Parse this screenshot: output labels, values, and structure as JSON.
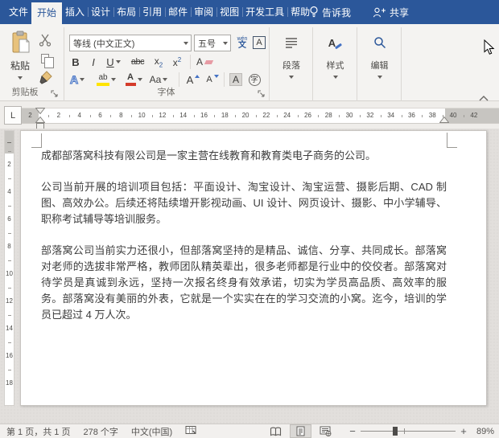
{
  "titlebar": {
    "tabs": [
      {
        "label": "文件",
        "active": false
      },
      {
        "label": "开始",
        "active": true
      },
      {
        "label": "插入",
        "active": false
      },
      {
        "label": "设计",
        "active": false
      },
      {
        "label": "布局",
        "active": false
      },
      {
        "label": "引用",
        "active": false
      },
      {
        "label": "邮件",
        "active": false
      },
      {
        "label": "审阅",
        "active": false
      },
      {
        "label": "视图",
        "active": false
      },
      {
        "label": "开发工具",
        "active": false
      },
      {
        "label": "帮助",
        "active": false
      }
    ],
    "tell_me": "告诉我",
    "share": "共享"
  },
  "ribbon": {
    "clipboard": {
      "group_label": "剪贴板",
      "paste_label": "粘贴"
    },
    "font": {
      "group_label": "字体",
      "font_name": "等线 (中文正文)",
      "font_size": "五号",
      "bold": "B",
      "italic": "I",
      "underline": "U",
      "strikethrough": "abc",
      "subscript_base": "x",
      "subscript_mark": "2",
      "superscript_base": "x",
      "superscript_mark": "2",
      "clear_format": "A",
      "text_effects": "A",
      "highlight": "ab",
      "font_color": "A",
      "change_case": "Aa",
      "grow_font": "A",
      "shrink_font": "A",
      "char_shading": "A",
      "enclose_char": "字",
      "phonetic_top": "wén",
      "phonetic_bottom": "文",
      "char_border": "A"
    },
    "paragraph_group": "段落",
    "styles_group": "样式",
    "editing_group": "编辑"
  },
  "ruler": {
    "h_margin_left_number": "2",
    "h_numbers": [
      "2",
      "4",
      "6",
      "8",
      "10",
      "12",
      "14",
      "16",
      "18",
      "20",
      "22",
      "24",
      "26",
      "28",
      "30",
      "32",
      "34",
      "36",
      "38",
      "40",
      "42"
    ],
    "v_numbers": [
      "2",
      "4",
      "6",
      "8",
      "10",
      "12",
      "14",
      "16",
      "18"
    ]
  },
  "document": {
    "paragraphs": [
      "成都部落窝科技有限公司是一家主营在线教育和教育类电子商务的公司。",
      "公司当前开展的培训项目包括：平面设计、淘宝设计、淘宝运营、摄影后期、CAD 制图、高效办公。后续还将陆续增开影视动画、UI 设计、网页设计、摄影、中小学辅导、职称考试辅导等培训服务。",
      "部落窝公司当前实力还很小，但部落窝坚持的是精品、诚信、分享、共同成长。部落窝对老师的选拔非常严格，教师团队精英辈出，很多老师都是行业中的佼佼者。部落窝对待学员是真诚到永远，坚持一次报名终身有效承诺，切实为学员高品质、高效率的服务。部落窝没有美丽的外表，它就是一个实实在在的学习交流的小窝。迄今，培训的学员已超过 4 万人次。"
    ]
  },
  "statusbar": {
    "page_info": "第 1 页，共 1 页",
    "word_count": "278 个字",
    "language": "中文(中国)",
    "zoom_minus": "−",
    "zoom_plus": "+",
    "zoom_level": "89%",
    "ruler_tab_selector": "L"
  },
  "colors": {
    "titlebar_blue": "#2b579a",
    "accent_blue": "#4472c4",
    "highlight_yellow": "#ffe400",
    "font_color_red": "#d43b2a",
    "clipboard_tan": "#e8c27c",
    "pasteboard_gray": "#e2dfdc"
  }
}
